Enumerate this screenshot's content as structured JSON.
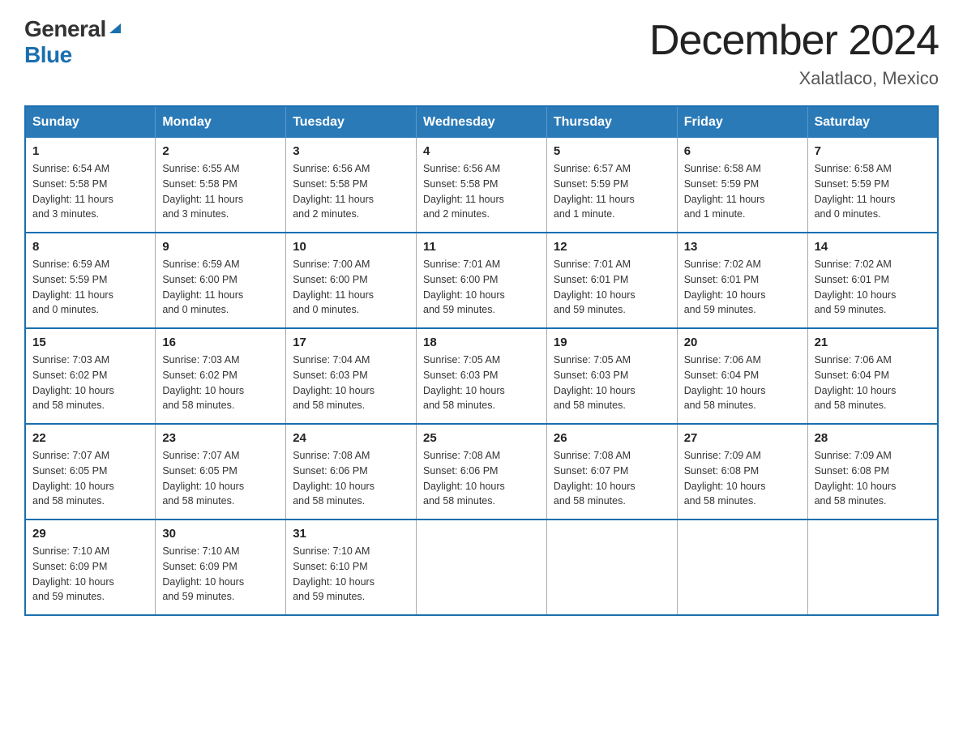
{
  "header": {
    "logo_general": "General",
    "logo_blue": "Blue",
    "month_title": "December 2024",
    "location": "Xalatlaco, Mexico"
  },
  "days_of_week": [
    "Sunday",
    "Monday",
    "Tuesday",
    "Wednesday",
    "Thursday",
    "Friday",
    "Saturday"
  ],
  "weeks": [
    [
      {
        "day": "1",
        "info": "Sunrise: 6:54 AM\nSunset: 5:58 PM\nDaylight: 11 hours\nand 3 minutes."
      },
      {
        "day": "2",
        "info": "Sunrise: 6:55 AM\nSunset: 5:58 PM\nDaylight: 11 hours\nand 3 minutes."
      },
      {
        "day": "3",
        "info": "Sunrise: 6:56 AM\nSunset: 5:58 PM\nDaylight: 11 hours\nand 2 minutes."
      },
      {
        "day": "4",
        "info": "Sunrise: 6:56 AM\nSunset: 5:58 PM\nDaylight: 11 hours\nand 2 minutes."
      },
      {
        "day": "5",
        "info": "Sunrise: 6:57 AM\nSunset: 5:59 PM\nDaylight: 11 hours\nand 1 minute."
      },
      {
        "day": "6",
        "info": "Sunrise: 6:58 AM\nSunset: 5:59 PM\nDaylight: 11 hours\nand 1 minute."
      },
      {
        "day": "7",
        "info": "Sunrise: 6:58 AM\nSunset: 5:59 PM\nDaylight: 11 hours\nand 0 minutes."
      }
    ],
    [
      {
        "day": "8",
        "info": "Sunrise: 6:59 AM\nSunset: 5:59 PM\nDaylight: 11 hours\nand 0 minutes."
      },
      {
        "day": "9",
        "info": "Sunrise: 6:59 AM\nSunset: 6:00 PM\nDaylight: 11 hours\nand 0 minutes."
      },
      {
        "day": "10",
        "info": "Sunrise: 7:00 AM\nSunset: 6:00 PM\nDaylight: 11 hours\nand 0 minutes."
      },
      {
        "day": "11",
        "info": "Sunrise: 7:01 AM\nSunset: 6:00 PM\nDaylight: 10 hours\nand 59 minutes."
      },
      {
        "day": "12",
        "info": "Sunrise: 7:01 AM\nSunset: 6:01 PM\nDaylight: 10 hours\nand 59 minutes."
      },
      {
        "day": "13",
        "info": "Sunrise: 7:02 AM\nSunset: 6:01 PM\nDaylight: 10 hours\nand 59 minutes."
      },
      {
        "day": "14",
        "info": "Sunrise: 7:02 AM\nSunset: 6:01 PM\nDaylight: 10 hours\nand 59 minutes."
      }
    ],
    [
      {
        "day": "15",
        "info": "Sunrise: 7:03 AM\nSunset: 6:02 PM\nDaylight: 10 hours\nand 58 minutes."
      },
      {
        "day": "16",
        "info": "Sunrise: 7:03 AM\nSunset: 6:02 PM\nDaylight: 10 hours\nand 58 minutes."
      },
      {
        "day": "17",
        "info": "Sunrise: 7:04 AM\nSunset: 6:03 PM\nDaylight: 10 hours\nand 58 minutes."
      },
      {
        "day": "18",
        "info": "Sunrise: 7:05 AM\nSunset: 6:03 PM\nDaylight: 10 hours\nand 58 minutes."
      },
      {
        "day": "19",
        "info": "Sunrise: 7:05 AM\nSunset: 6:03 PM\nDaylight: 10 hours\nand 58 minutes."
      },
      {
        "day": "20",
        "info": "Sunrise: 7:06 AM\nSunset: 6:04 PM\nDaylight: 10 hours\nand 58 minutes."
      },
      {
        "day": "21",
        "info": "Sunrise: 7:06 AM\nSunset: 6:04 PM\nDaylight: 10 hours\nand 58 minutes."
      }
    ],
    [
      {
        "day": "22",
        "info": "Sunrise: 7:07 AM\nSunset: 6:05 PM\nDaylight: 10 hours\nand 58 minutes."
      },
      {
        "day": "23",
        "info": "Sunrise: 7:07 AM\nSunset: 6:05 PM\nDaylight: 10 hours\nand 58 minutes."
      },
      {
        "day": "24",
        "info": "Sunrise: 7:08 AM\nSunset: 6:06 PM\nDaylight: 10 hours\nand 58 minutes."
      },
      {
        "day": "25",
        "info": "Sunrise: 7:08 AM\nSunset: 6:06 PM\nDaylight: 10 hours\nand 58 minutes."
      },
      {
        "day": "26",
        "info": "Sunrise: 7:08 AM\nSunset: 6:07 PM\nDaylight: 10 hours\nand 58 minutes."
      },
      {
        "day": "27",
        "info": "Sunrise: 7:09 AM\nSunset: 6:08 PM\nDaylight: 10 hours\nand 58 minutes."
      },
      {
        "day": "28",
        "info": "Sunrise: 7:09 AM\nSunset: 6:08 PM\nDaylight: 10 hours\nand 58 minutes."
      }
    ],
    [
      {
        "day": "29",
        "info": "Sunrise: 7:10 AM\nSunset: 6:09 PM\nDaylight: 10 hours\nand 59 minutes."
      },
      {
        "day": "30",
        "info": "Sunrise: 7:10 AM\nSunset: 6:09 PM\nDaylight: 10 hours\nand 59 minutes."
      },
      {
        "day": "31",
        "info": "Sunrise: 7:10 AM\nSunset: 6:10 PM\nDaylight: 10 hours\nand 59 minutes."
      },
      {
        "day": "",
        "info": ""
      },
      {
        "day": "",
        "info": ""
      },
      {
        "day": "",
        "info": ""
      },
      {
        "day": "",
        "info": ""
      }
    ]
  ]
}
